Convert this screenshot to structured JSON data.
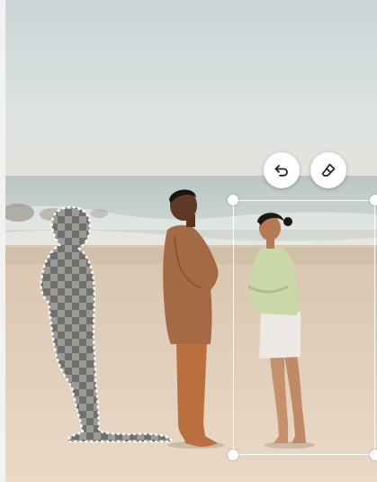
{
  "toolbar": {
    "undo_icon": "undo-icon",
    "eraser_icon": "eraser-icon"
  },
  "scene": {
    "sky_color": "#cfdbdd",
    "sand_color": "#e3d2bc",
    "selection_color": "#ffffff",
    "erased_pattern": "checkerboard"
  }
}
